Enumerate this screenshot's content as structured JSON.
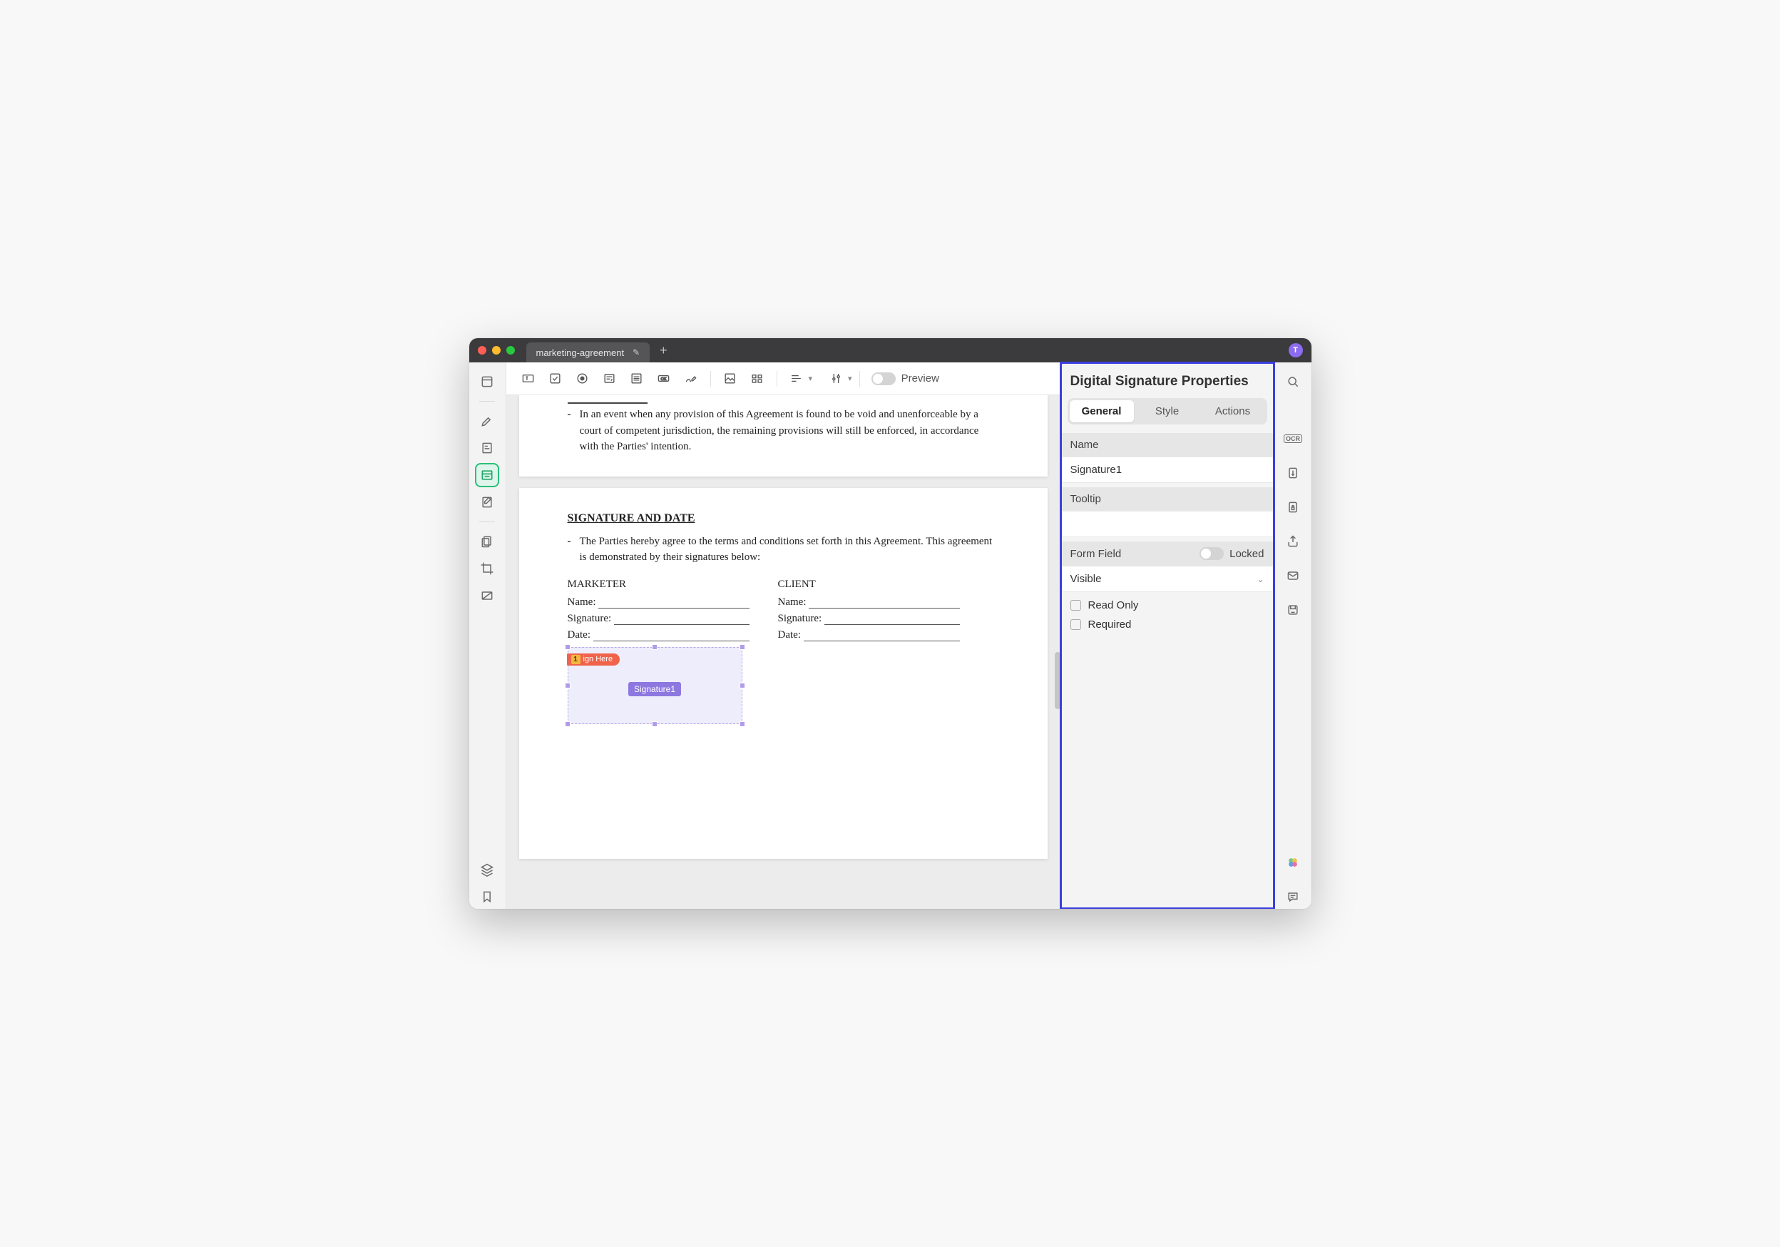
{
  "tab": {
    "title": "marketing-agreement",
    "edit_icon": "✎"
  },
  "avatar": {
    "letter": "T"
  },
  "toolbar": {
    "preview_label": "Preview"
  },
  "doc": {
    "prov_text": "In an event when any provision of this Agreement is found to be void and unenforceable by a court of competent jurisdiction, the remaining provisions will still be enforced, in accordance with the Parties' intention.",
    "sig_heading": "SIGNATURE AND DATE",
    "sig_intro": "The Parties hereby agree to the terms and conditions set forth in this Agreement. This agreement is demonstrated by their signatures below:",
    "col1": "MARKETER",
    "col2": "CLIENT",
    "name_lbl": "Name:",
    "sign_lbl": "Signature:",
    "date_lbl": "Date:"
  },
  "sigfield": {
    "tag_number": "1",
    "tag_text": "ign Here",
    "label": "Signature1"
  },
  "properties": {
    "title": "Digital Signature Properties",
    "tabs": {
      "general": "General",
      "style": "Style",
      "actions": "Actions"
    },
    "name_label": "Name",
    "name_value": "Signature1",
    "tooltip_label": "Tooltip",
    "tooltip_value": "",
    "formfield_label": "Form Field",
    "locked_label": "Locked",
    "visibility_value": "Visible",
    "readonly_label": "Read Only",
    "required_label": "Required"
  },
  "rightbar": {
    "ocr": "OCR"
  }
}
